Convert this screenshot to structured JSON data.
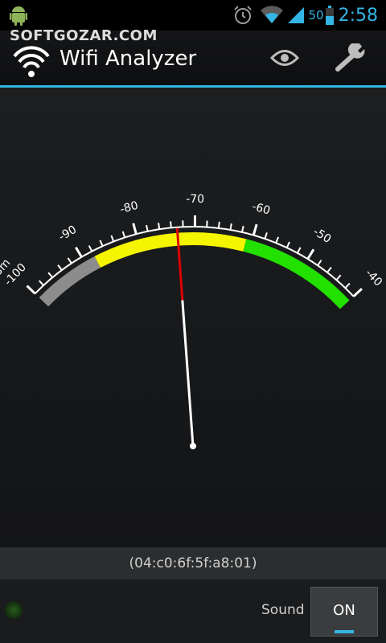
{
  "status_bar": {
    "battery_level": "50",
    "time": "2:58",
    "icons": [
      "android-icon",
      "alarm-icon",
      "wifi-icon",
      "signal-icon",
      "battery-icon"
    ]
  },
  "watermark": {
    "text": "SOFTGOZAR.COM"
  },
  "action_bar": {
    "title": "Wifi Analyzer",
    "actions": [
      "eye-icon",
      "wrench-icon"
    ]
  },
  "meter": {
    "unit_label": "dBm",
    "tick_labels": [
      "-100",
      "-90",
      "-80",
      "-70",
      "-60",
      "-50",
      "-40"
    ],
    "scale_min": -100,
    "scale_max": -40,
    "needle_value": -73,
    "zones": [
      {
        "from": -100,
        "to": -88,
        "color": "#8c8c8c"
      },
      {
        "from": -88,
        "to": -61,
        "color": "#f5f500"
      },
      {
        "from": -61,
        "to": -40,
        "color": "#22e000"
      }
    ],
    "needle_color": "#ffffff",
    "needle_tip_color": "#dd0000"
  },
  "ap_info": {
    "mac": "(04:c0:6f:5f:a8:01)"
  },
  "bottom_bar": {
    "sound_label": "Sound",
    "toggle_label": "ON",
    "accent_color": "#33b5e5"
  }
}
